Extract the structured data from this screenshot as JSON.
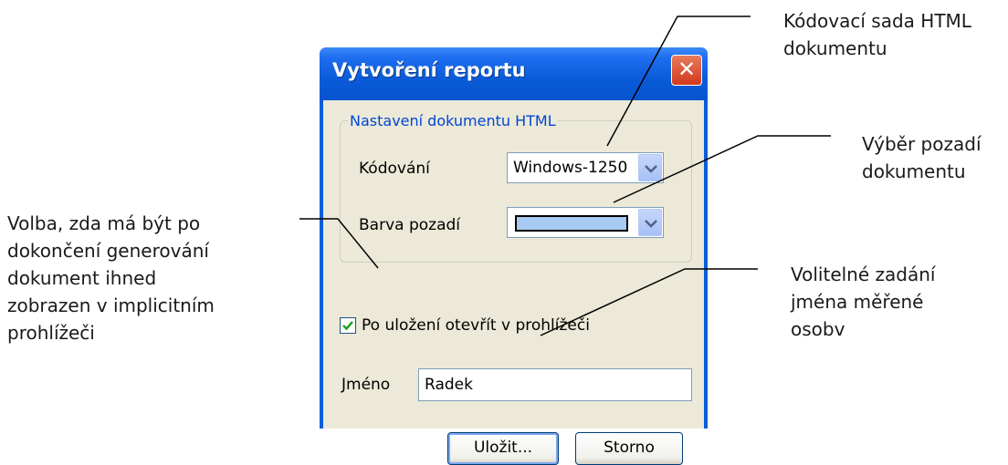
{
  "dialog": {
    "title": "Vytvoření reportu",
    "close_glyph": "✕",
    "group_title": "Nastavení dokumentu HTML",
    "encoding_label": "Kódování",
    "encoding_value": "Windows-1250",
    "background_label": "Barva pozadí",
    "background_color": "#a6caf0",
    "open_in_browser_label": "Po uložení otevřít v prohlížeči",
    "open_in_browser_checked": true,
    "name_label": "Jméno",
    "name_value": "Radek",
    "save_label": "Uložit...",
    "cancel_label": "Storno"
  },
  "callouts": {
    "encoding_line1": "Kódovací sada HTML",
    "encoding_line2": "dokumentu",
    "background_line1": "Výběr pozadí",
    "background_line2": "dokumentu",
    "browser_line1": "Volba, zda má být po",
    "browser_line2": "dokončení generování",
    "browser_line3": "dokument ihned",
    "browser_line4": "zobrazen v implicitním",
    "browser_line5": "prohlížeči",
    "name_line1": "Volitelné zadání",
    "name_line2": "jména měřené",
    "name_line3": "osobv"
  },
  "icons": {
    "close": "close-icon",
    "dropdown": "chevron-down-icon",
    "check": "checkmark-icon"
  }
}
